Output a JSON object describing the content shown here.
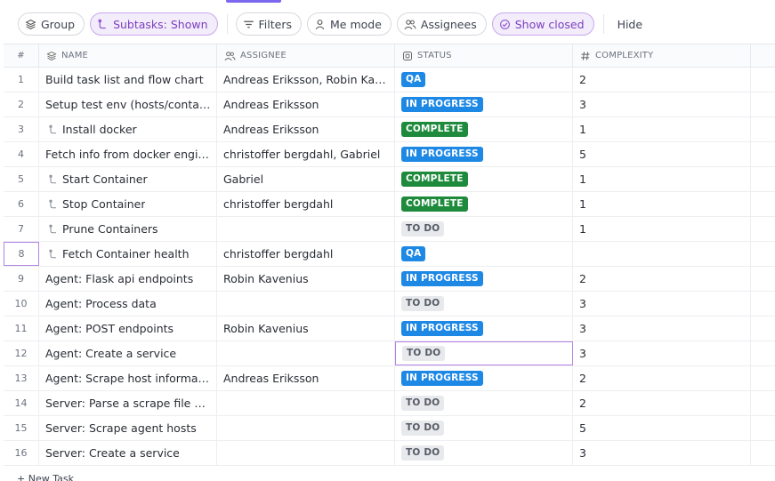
{
  "toolbar": {
    "group_label": "Group",
    "subtasks_label": "Subtasks: Shown",
    "filters_label": "Filters",
    "me_mode_label": "Me mode",
    "assignees_label": "Assignees",
    "show_closed_label": "Show closed",
    "hide_label": "Hide"
  },
  "columns": {
    "number": "#",
    "name": "NAME",
    "assignee": "ASSIGNEE",
    "status": "STATUS",
    "complexity": "COMPLEXITY"
  },
  "status_colors": {
    "QA": {
      "bg": "#1e88e5",
      "fg": "#ffffff"
    },
    "IN PROGRESS": {
      "bg": "#1e88e5",
      "fg": "#ffffff"
    },
    "COMPLETE": {
      "bg": "#1e8a3c",
      "fg": "#ffffff"
    },
    "TO DO": {
      "bg": "#e8e9ec",
      "fg": "#555b66"
    }
  },
  "tasks": [
    {
      "num": "1",
      "name": "Build task list and flow chart",
      "subtask": false,
      "assignee": "Andreas Eriksson, Robin Kave…",
      "status": "QA",
      "complexity": "2"
    },
    {
      "num": "2",
      "name": "Setup test env (hosts/containe…",
      "subtask": false,
      "assignee": "Andreas Eriksson",
      "status": "IN PROGRESS",
      "complexity": "3"
    },
    {
      "num": "3",
      "name": "Install docker",
      "subtask": true,
      "assignee": "Andreas Eriksson",
      "status": "COMPLETE",
      "complexity": "1"
    },
    {
      "num": "4",
      "name": "Fetch info from docker engine",
      "subtask": false,
      "assignee": "christoffer bergdahl, Gabriel",
      "status": "IN PROGRESS",
      "complexity": "5"
    },
    {
      "num": "5",
      "name": "Start Container",
      "subtask": true,
      "assignee": "Gabriel",
      "status": "COMPLETE",
      "complexity": "1"
    },
    {
      "num": "6",
      "name": "Stop Container",
      "subtask": true,
      "assignee": "christoffer bergdahl",
      "status": "COMPLETE",
      "complexity": "1"
    },
    {
      "num": "7",
      "name": "Prune Containers",
      "subtask": true,
      "assignee": "",
      "status": "TO DO",
      "complexity": "1"
    },
    {
      "num": "8",
      "name": "Fetch Container health",
      "subtask": true,
      "assignee": "christoffer bergdahl",
      "status": "QA",
      "complexity": ""
    },
    {
      "num": "9",
      "name": "Agent: Flask api endpoints",
      "subtask": false,
      "assignee": "Robin Kavenius",
      "status": "IN PROGRESS",
      "complexity": "2"
    },
    {
      "num": "10",
      "name": "Agent: Process data",
      "subtask": false,
      "assignee": "",
      "status": "TO DO",
      "complexity": "3"
    },
    {
      "num": "11",
      "name": "Agent: POST endpoints",
      "subtask": false,
      "assignee": "Robin Kavenius",
      "status": "IN PROGRESS",
      "complexity": "3"
    },
    {
      "num": "12",
      "name": "Agent: Create a service",
      "subtask": false,
      "assignee": "",
      "status": "TO DO",
      "complexity": "3"
    },
    {
      "num": "13",
      "name": "Agent: Scrape host information",
      "subtask": false,
      "assignee": "Andreas Eriksson",
      "status": "IN PROGRESS",
      "complexity": "2"
    },
    {
      "num": "14",
      "name": "Server: Parse a scrape file wit…",
      "subtask": false,
      "assignee": "",
      "status": "TO DO",
      "complexity": "2"
    },
    {
      "num": "15",
      "name": "Server: Scrape agent hosts",
      "subtask": false,
      "assignee": "",
      "status": "TO DO",
      "complexity": "5"
    },
    {
      "num": "16",
      "name": "Server: Create a service",
      "subtask": false,
      "assignee": "",
      "status": "TO DO",
      "complexity": "3"
    }
  ],
  "footer": {
    "new_task_label": "+ New Task"
  }
}
